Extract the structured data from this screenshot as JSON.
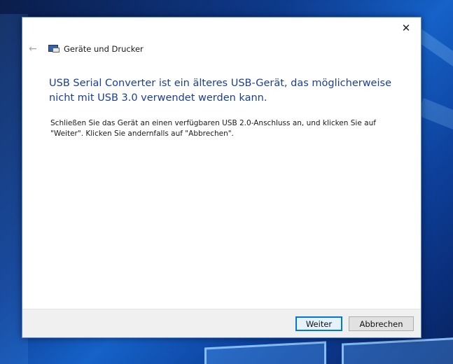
{
  "window": {
    "close_glyph": "✕",
    "back_glyph": "←",
    "breadcrumb": "Geräte und Drucker",
    "breadcrumb_icon": "devices-printers-icon"
  },
  "content": {
    "heading": "USB Serial Converter ist ein älteres USB-Gerät, das möglicherweise nicht mit USB 3.0 verwendet werden kann.",
    "body_line1": "Schließen Sie das Gerät an einen verfügbaren USB 2.0-Anschluss an, und klicken Sie auf",
    "body_line2": "\"Weiter\". Klicken Sie andernfalls auf \"Abbrechen\"."
  },
  "buttons": {
    "next": "Weiter",
    "cancel": "Abbrechen"
  },
  "colors": {
    "heading": "#1a3e9e",
    "accent": "#0078d7",
    "footer_bg": "#f0f0f0"
  }
}
